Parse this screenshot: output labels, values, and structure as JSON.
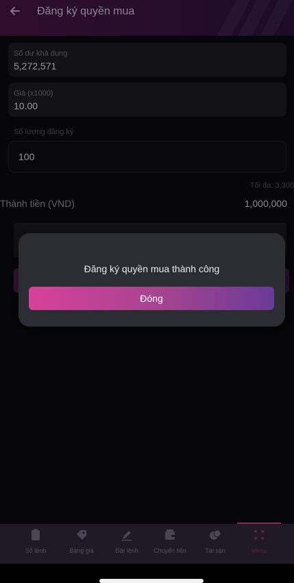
{
  "header": {
    "title": "Đăng ký quyền mua"
  },
  "form": {
    "balance": {
      "label": "Số dư khả dụng",
      "value": "5,272,571"
    },
    "price": {
      "label": "Giá (x1000)",
      "value": "10.00"
    },
    "quantity": {
      "label": "Số lượng đăng ký",
      "value": "100"
    },
    "max_text": "Tối đa: 3,300",
    "total_label": "Thành tiền (VND)",
    "total_value": "1,000,000"
  },
  "modal": {
    "message": "Đăng ký quyền mua thành công",
    "close_label": "Đóng"
  },
  "bottom_nav": {
    "items": [
      {
        "label": "Sổ lệnh",
        "icon": "clipboard-icon"
      },
      {
        "label": "Bảng giá",
        "icon": "tag-icon"
      },
      {
        "label": "Đặt lệnh",
        "icon": "pen-icon"
      },
      {
        "label": "Chuyển tiền",
        "icon": "wallet-icon"
      },
      {
        "label": "Tài sản",
        "icon": "coins-icon"
      },
      {
        "label": "Menu",
        "icon": "grid-icon"
      }
    ],
    "active_index": 5
  },
  "colors": {
    "accent_start": "#d8419a",
    "accent_end": "#6a3a98",
    "background": "#0b0b10"
  }
}
